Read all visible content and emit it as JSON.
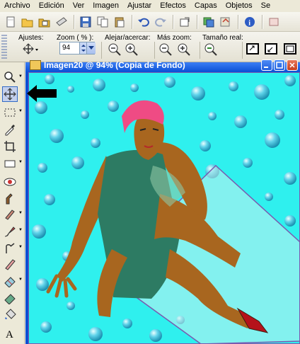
{
  "menubar": {
    "items": [
      "Archivo",
      "Edición",
      "Ver",
      "Imagen",
      "Ajustar",
      "Efectos",
      "Capas",
      "Objetos",
      "Se"
    ]
  },
  "toolbar": {
    "buttons": [
      "new-icon",
      "open-icon",
      "browse-icon",
      "scan-icon",
      "save-icon",
      "copy-icon",
      "paste-icon",
      "undo-icon",
      "redo-icon",
      "resize-icon",
      "layers-icon",
      "info-icon",
      "help-icon"
    ]
  },
  "options": {
    "ajustes_label": "Ajustes:",
    "zoom_label": "Zoom ( % ):",
    "zoom_value": "94",
    "alejar_label": "Alejar/acercar:",
    "mas_zoom_label": "Más zoom:",
    "tamano_label": "Tamaño real:"
  },
  "document": {
    "title": "Imagen20  @  94% (Copia de Fondo)"
  },
  "colors": {
    "canvas_bg": "#2ff0ee",
    "diamond": "#c9f3f0",
    "skin": "#a8661f",
    "dress": "#2d7b63",
    "hair": "#ef4b84",
    "title_bar": "#0a4fd4",
    "pointer": "#000000"
  },
  "tools": [
    "zoom-icon",
    "move-icon",
    "selection-icon",
    "dropper-icon",
    "crop-icon",
    "straighten-icon",
    "red-eye-icon",
    "clone-icon",
    "scratch-icon",
    "paint-brush-icon",
    "dodge-icon",
    "eraser-icon",
    "background-eraser-icon",
    "fill-icon",
    "shape-icon",
    "text-icon"
  ]
}
